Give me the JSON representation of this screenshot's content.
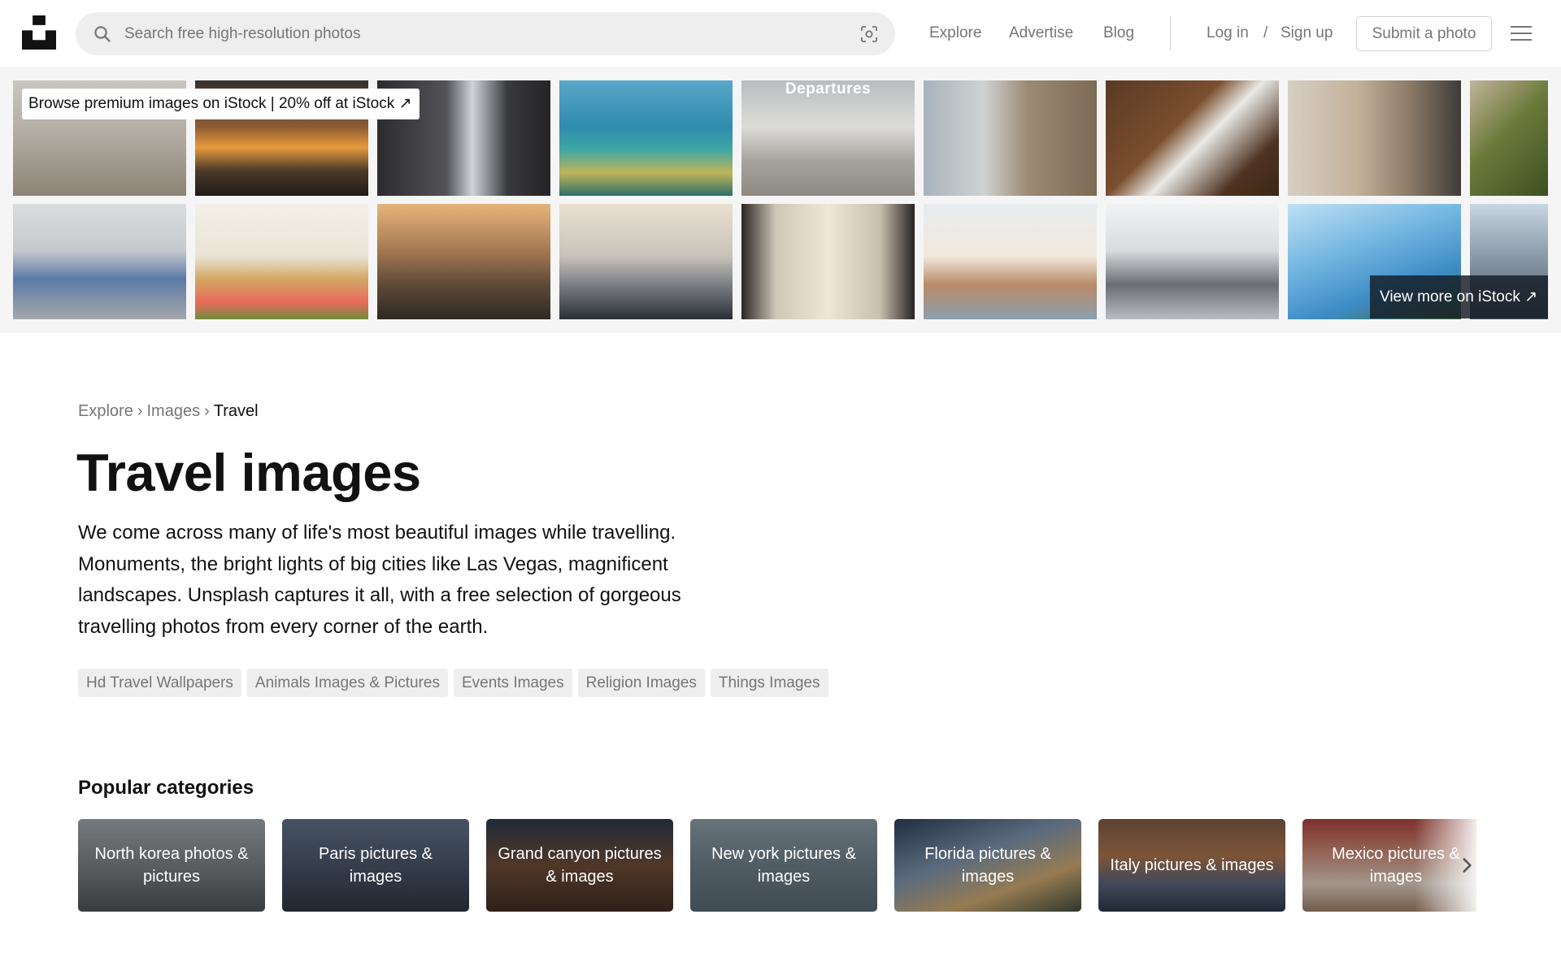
{
  "header": {
    "search_placeholder": "Search free high-resolution photos",
    "nav": [
      "Explore",
      "Advertise",
      "Blog"
    ],
    "login_label": "Log in",
    "auth_separator": "/",
    "signup_label": "Sign up",
    "submit_label": "Submit a photo"
  },
  "istock": {
    "promo_label": "Browse premium images on iStock | 20% off at iStock ↗",
    "departures_sign": "Departures",
    "view_more_label": "View more on iStock ↗"
  },
  "breadcrumb": {
    "items": [
      "Explore",
      "Images"
    ],
    "separator": "›",
    "current": "Travel"
  },
  "page": {
    "title": "Travel images",
    "description": "We come across many of life's most beautiful images while travelling. Monuments, the bright lights of big cities like Las Vegas, magnificent landscapes. Unsplash captures it all, with a free selection of gorgeous travelling photos from every corner of the earth."
  },
  "related_tags": [
    "Hd Travel Wallpapers",
    "Animals Images & Pictures",
    "Events Images",
    "Religion Images",
    "Things Images"
  ],
  "popular": {
    "heading": "Popular categories",
    "categories": [
      "North korea photos & pictures",
      "Paris pictures & images",
      "Grand canyon pictures & images",
      "New york pictures & images",
      "Florida pictures & images",
      "Italy pictures & images",
      "Mexico pictures & images"
    ]
  },
  "colors": {
    "text_primary": "#111111",
    "text_muted": "#767676",
    "surface": "#eeeeee",
    "banner_bg": "#f5f5f5"
  }
}
